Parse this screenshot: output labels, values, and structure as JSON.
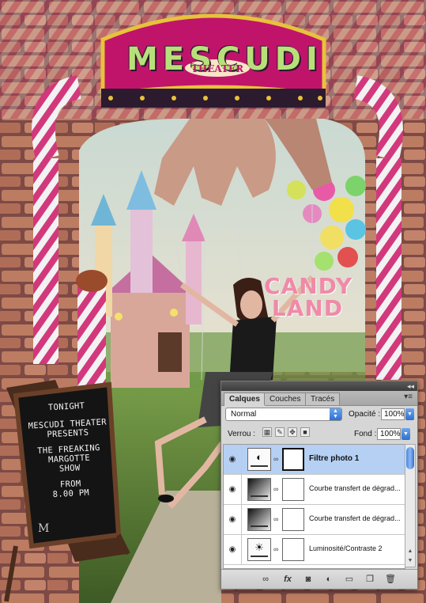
{
  "artwork": {
    "marquee_title": "MESCUDI",
    "marquee_subtitle": "THEATER",
    "candy_sign": "CANDY LAND",
    "chalkboard_lines": [
      "TONIGHT",
      "MESCUDI THEATER",
      "PRESENTS",
      "THE FREAKING",
      "MARGOTTE",
      "SHOW",
      "FROM",
      "8.00 PM"
    ],
    "chalkboard_logo": "M"
  },
  "panel": {
    "tabs": [
      "Calques",
      "Couches",
      "Tracés"
    ],
    "active_tab": "Calques",
    "blend_mode": "Normal",
    "opacity_label": "Opacité :",
    "opacity_value": "100%",
    "lock_label": "Verrou :",
    "fill_label": "Fond :",
    "fill_value": "100%",
    "layers": [
      {
        "name": "Filtre photo 1",
        "selected": true,
        "icon": "photo-filter-icon"
      },
      {
        "name": "Courbe transfert de dégrad...",
        "selected": false,
        "icon": "gradient-map-icon"
      },
      {
        "name": "Courbe transfert de dégrad...",
        "selected": false,
        "icon": "gradient-map-icon"
      },
      {
        "name": "Luminosité/Contraste 2",
        "selected": false,
        "icon": "brightness-contrast-icon"
      }
    ],
    "footer_icons": [
      "link-layers-icon",
      "fx-icon",
      "add-mask-icon",
      "adjustment-layer-icon",
      "new-group-icon",
      "new-layer-icon",
      "trash-icon"
    ]
  }
}
